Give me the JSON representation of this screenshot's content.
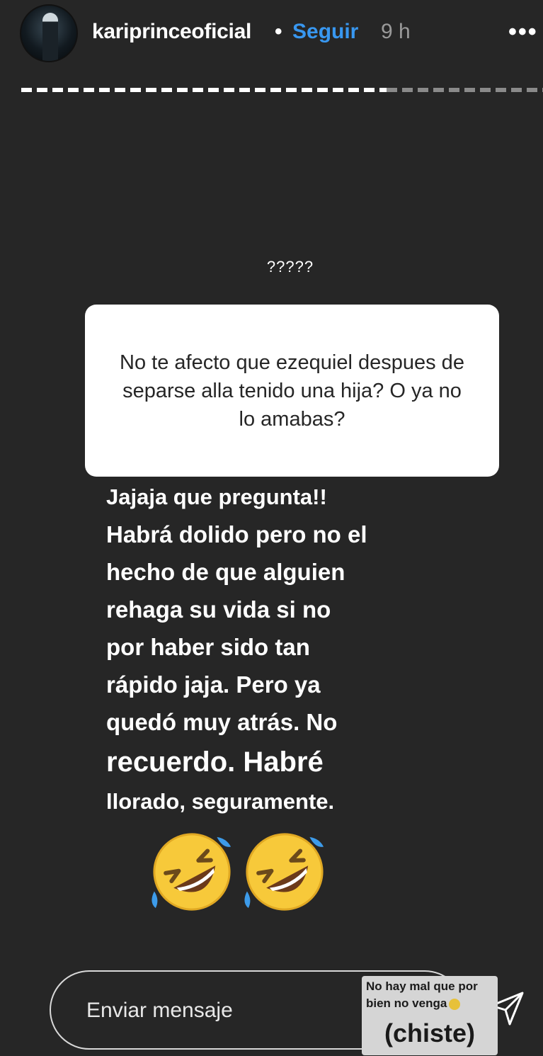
{
  "header": {
    "username": "kariprinceoficial",
    "separator": "•",
    "follow_label": "Seguir",
    "time": "9 h",
    "more_label": "•••"
  },
  "story_progress": {
    "segments_total": 1,
    "viewed_fraction": 0.7
  },
  "question_sticker": {
    "top_label": "?????",
    "question": "No te afecto que ezequiel despues de separse alla tenido una hija? O ya no lo amabas?"
  },
  "answer": {
    "lines": [
      "Jajaja que pregunta!!",
      "Habrá dolido pero no el",
      "hecho de que alguien",
      "rehaga su vida si no",
      "por haber sido tan",
      "rápido jaja. Pero ya",
      "quedó muy atrás. No",
      "recuerdo. Habré",
      "llorado, seguramente."
    ]
  },
  "emojis": [
    "rolling-on-floor-laughing-emoji",
    "rolling-on-floor-laughing-emoji"
  ],
  "message": {
    "placeholder": "Enviar mensaje"
  },
  "note": {
    "line1": "No hay mal que por",
    "line2": "bien no venga",
    "big": "(chiste)"
  },
  "colors": {
    "background": "#262626",
    "accent": "#3897f0",
    "sticker_bg": "#ffffff"
  }
}
